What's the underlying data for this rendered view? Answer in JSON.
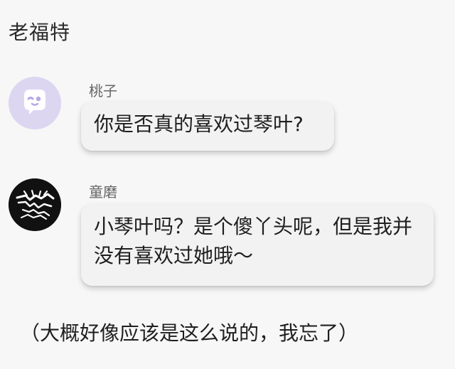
{
  "header": {
    "title": "老福特"
  },
  "messages": [
    {
      "sender": "桃子",
      "text": "你是否真的喜欢过琴叶?",
      "avatar_icon": "purple-chat-bubble-face-icon",
      "avatar_color": "#dcd6f1"
    },
    {
      "sender": "童磨",
      "text": "小琴叶吗？是个傻丫头呢，但是我并没有喜欢过她哦～",
      "avatar_icon": "black-white-illustration-avatar-icon",
      "avatar_color": "#111111"
    }
  ],
  "footer": {
    "note": "（大概好像应该是这么说的，我忘了）"
  }
}
